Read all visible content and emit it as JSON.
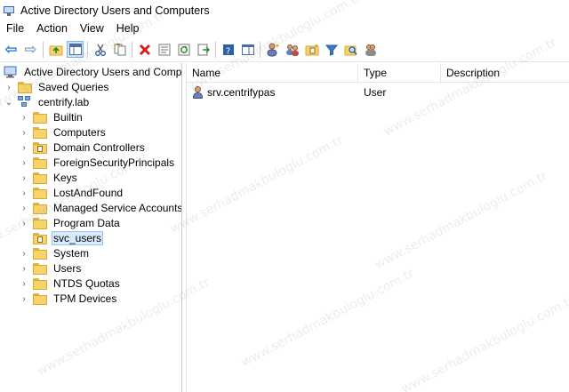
{
  "window": {
    "title": "Active Directory Users and Computers"
  },
  "menu": [
    "File",
    "Action",
    "View",
    "Help"
  ],
  "toolbar": {
    "buttons": [
      "back-icon",
      "forward-icon",
      "up-folder-icon",
      "show-tree-icon",
      "cut-icon",
      "copy-icon",
      "delete-icon",
      "properties-icon",
      "refresh-icon",
      "export-icon",
      "help-icon",
      "console-icon",
      "new-user-icon",
      "new-group-icon",
      "new-ou-icon",
      "filter-icon",
      "find-icon",
      "add-to-group-icon"
    ]
  },
  "tree": {
    "root": "Active Directory Users and Computers",
    "saved_queries": "Saved Queries",
    "domain": "centrify.lab",
    "items": [
      "Builtin",
      "Computers",
      "Domain Controllers",
      "ForeignSecurityPrincipals",
      "Keys",
      "LostAndFound",
      "Managed Service Accounts",
      "Program Data",
      "svc_users",
      "System",
      "Users",
      "NTDS Quotas",
      "TPM Devices"
    ],
    "selected": "svc_users"
  },
  "list": {
    "columns": [
      "Name",
      "Type",
      "Description"
    ],
    "rows": [
      {
        "name": "srv.centrifypas",
        "type": "User",
        "description": ""
      }
    ]
  },
  "watermark": "www.serhadmakbuloglu.com.tr",
  "colors": {
    "selection_bg": "#d9ebfb",
    "selection_border": "#99c7ef",
    "folder": "#f6d46b"
  }
}
